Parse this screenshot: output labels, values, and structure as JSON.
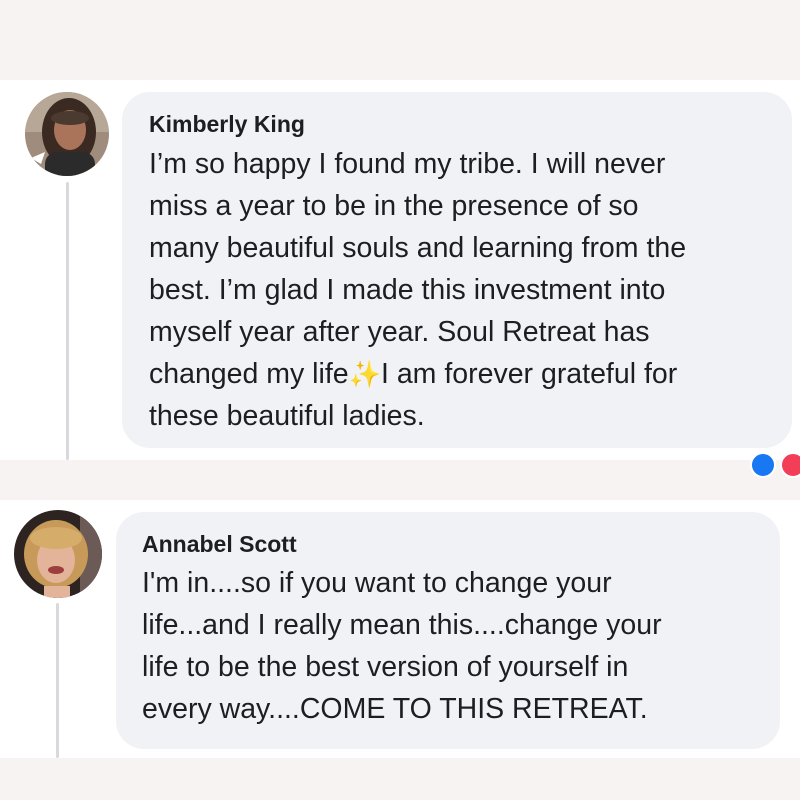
{
  "comments": [
    {
      "author": "Kimberly King",
      "text_before_emoji": "I’m so happy I found my tribe. I will never\nmiss a year to be in the presence of so\nmany beautiful souls and learning from the\nbest. I’m glad I made this investment into\nmyself year after year. Soul Retreat has\nchanged my life",
      "emoji": "✨",
      "text_after_emoji": "I am forever grateful for\nthese beautiful ladies.",
      "avatar_icon": "profile-photo-woman-dark-hair"
    },
    {
      "author": "Annabel Scott",
      "text": "I'm in....so if you want to change your\nlife...and I really mean this....change your\nlife to be the best version of yourself in\nevery way....COME TO THIS RETREAT.",
      "avatar_icon": "profile-photo-woman-blonde-hair"
    }
  ],
  "colors": {
    "page_background": "#f8f3f3",
    "card_background": "#ffffff",
    "bubble_background": "#f0f2f5",
    "text": "#1c1e21",
    "thread_line": "#d7d9dd",
    "reaction_like": "#1877f2",
    "reaction_love": "#f33e58"
  }
}
